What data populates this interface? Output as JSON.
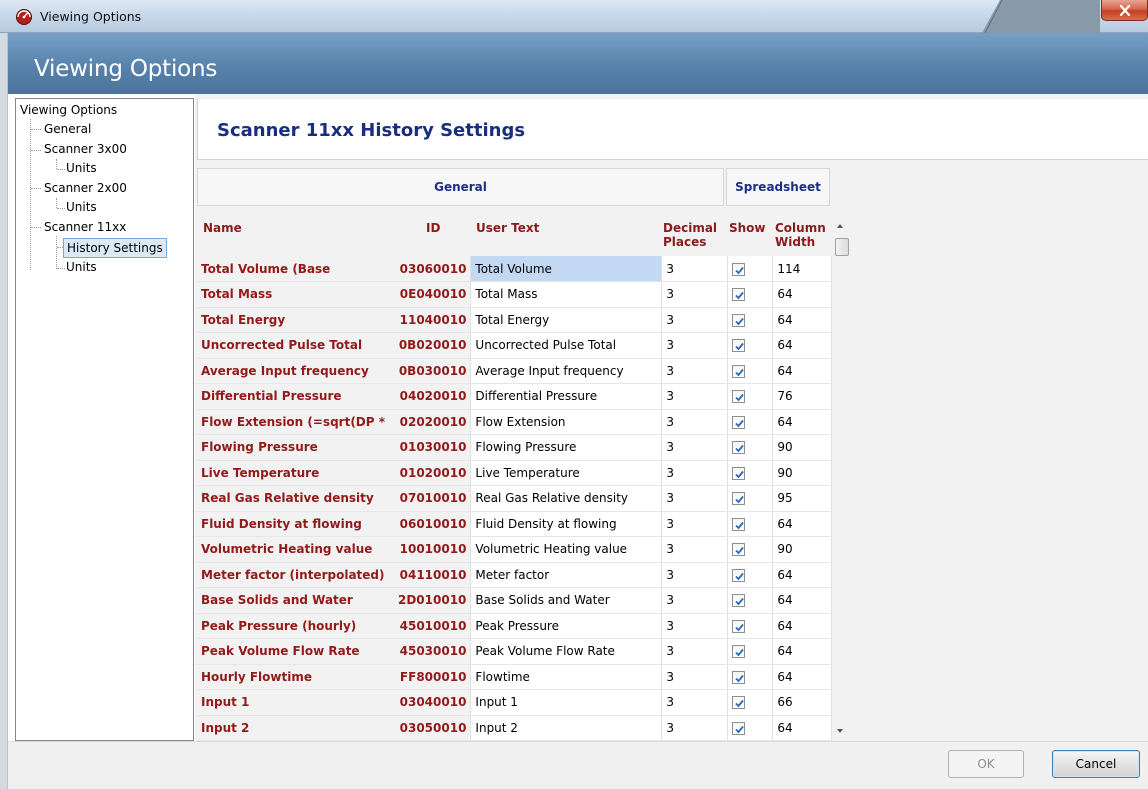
{
  "window": {
    "title": "Viewing Options",
    "app_icon": "red-gauge-icon",
    "close_icon": "close-icon"
  },
  "header": {
    "title": "Viewing Options"
  },
  "tree": {
    "root": "Viewing Options",
    "items": [
      {
        "label": "General"
      },
      {
        "label": "Scanner 3x00"
      },
      {
        "label": "Units"
      },
      {
        "label": "Scanner 2x00"
      },
      {
        "label": "Units"
      },
      {
        "label": "Scanner 11xx"
      },
      {
        "label": "History Settings",
        "selected": true
      },
      {
        "label": "Units"
      }
    ]
  },
  "section": {
    "title": "Scanner 11xx History Settings"
  },
  "grid": {
    "groups": {
      "general": "General",
      "spreadsheet": "Spreadsheet"
    },
    "columns": {
      "name": "Name",
      "id": "ID",
      "user_text": "User Text",
      "decimal_places_line1": "Decimal",
      "decimal_places_line2": "Places",
      "show": "Show",
      "column_width_line1": "Column",
      "column_width_line2": "Width"
    },
    "rows": [
      {
        "name": "Total Volume (Base",
        "id": "03060010",
        "user_text": "Total Volume",
        "decimals": "3",
        "show": true,
        "width": "114"
      },
      {
        "name": "Total Mass",
        "id": "0E040010",
        "user_text": "Total Mass",
        "decimals": "3",
        "show": true,
        "width": "64"
      },
      {
        "name": "Total Energy",
        "id": "11040010",
        "user_text": "Total Energy",
        "decimals": "3",
        "show": true,
        "width": "64"
      },
      {
        "name": "Uncorrected Pulse Total",
        "id": "0B020010",
        "user_text": "Uncorrected Pulse Total",
        "decimals": "3",
        "show": true,
        "width": "64"
      },
      {
        "name": "Average Input frequency",
        "id": "0B030010",
        "user_text": "Average Input frequency",
        "decimals": "3",
        "show": true,
        "width": "64"
      },
      {
        "name": "Differential Pressure",
        "id": "04020010",
        "user_text": "Differential Pressure",
        "decimals": "3",
        "show": true,
        "width": "76"
      },
      {
        "name": "Flow Extension (=sqrt(DP *",
        "id": "02020010",
        "user_text": "Flow Extension",
        "decimals": "3",
        "show": true,
        "width": "64"
      },
      {
        "name": "Flowing Pressure",
        "id": "01030010",
        "user_text": "Flowing Pressure",
        "decimals": "3",
        "show": true,
        "width": "90"
      },
      {
        "name": "Live Temperature",
        "id": "01020010",
        "user_text": "Live Temperature",
        "decimals": "3",
        "show": true,
        "width": "90"
      },
      {
        "name": "Real Gas Relative density",
        "id": "07010010",
        "user_text": "Real Gas Relative density",
        "decimals": "3",
        "show": true,
        "width": "95"
      },
      {
        "name": "Fluid Density at flowing",
        "id": "06010010",
        "user_text": "Fluid Density at flowing",
        "decimals": "3",
        "show": true,
        "width": "64"
      },
      {
        "name": "Volumetric Heating value",
        "id": "10010010",
        "user_text": "Volumetric Heating value",
        "decimals": "3",
        "show": true,
        "width": "90"
      },
      {
        "name": "Meter factor (interpolated)",
        "id": "04110010",
        "user_text": "Meter factor",
        "decimals": "3",
        "show": true,
        "width": "64"
      },
      {
        "name": "Base Solids and Water",
        "id": "2D010010",
        "user_text": "Base Solids and Water",
        "decimals": "3",
        "show": true,
        "width": "64"
      },
      {
        "name": "Peak Pressure (hourly)",
        "id": "45010010",
        "user_text": "Peak Pressure",
        "decimals": "3",
        "show": true,
        "width": "64"
      },
      {
        "name": "Peak Volume Flow Rate",
        "id": "45030010",
        "user_text": "Peak Volume Flow Rate",
        "decimals": "3",
        "show": true,
        "width": "64"
      },
      {
        "name": "Hourly Flowtime",
        "id": "FF800010",
        "user_text": "Flowtime",
        "decimals": "3",
        "show": true,
        "width": "64"
      },
      {
        "name": "Input 1",
        "id": "03040010",
        "user_text": "Input 1",
        "decimals": "3",
        "show": true,
        "width": "66"
      },
      {
        "name": "Input 2",
        "id": "03050010",
        "user_text": "Input 2",
        "decimals": "3",
        "show": true,
        "width": "64"
      }
    ]
  },
  "footer": {
    "ok_label": "OK",
    "cancel_label": "Cancel"
  }
}
